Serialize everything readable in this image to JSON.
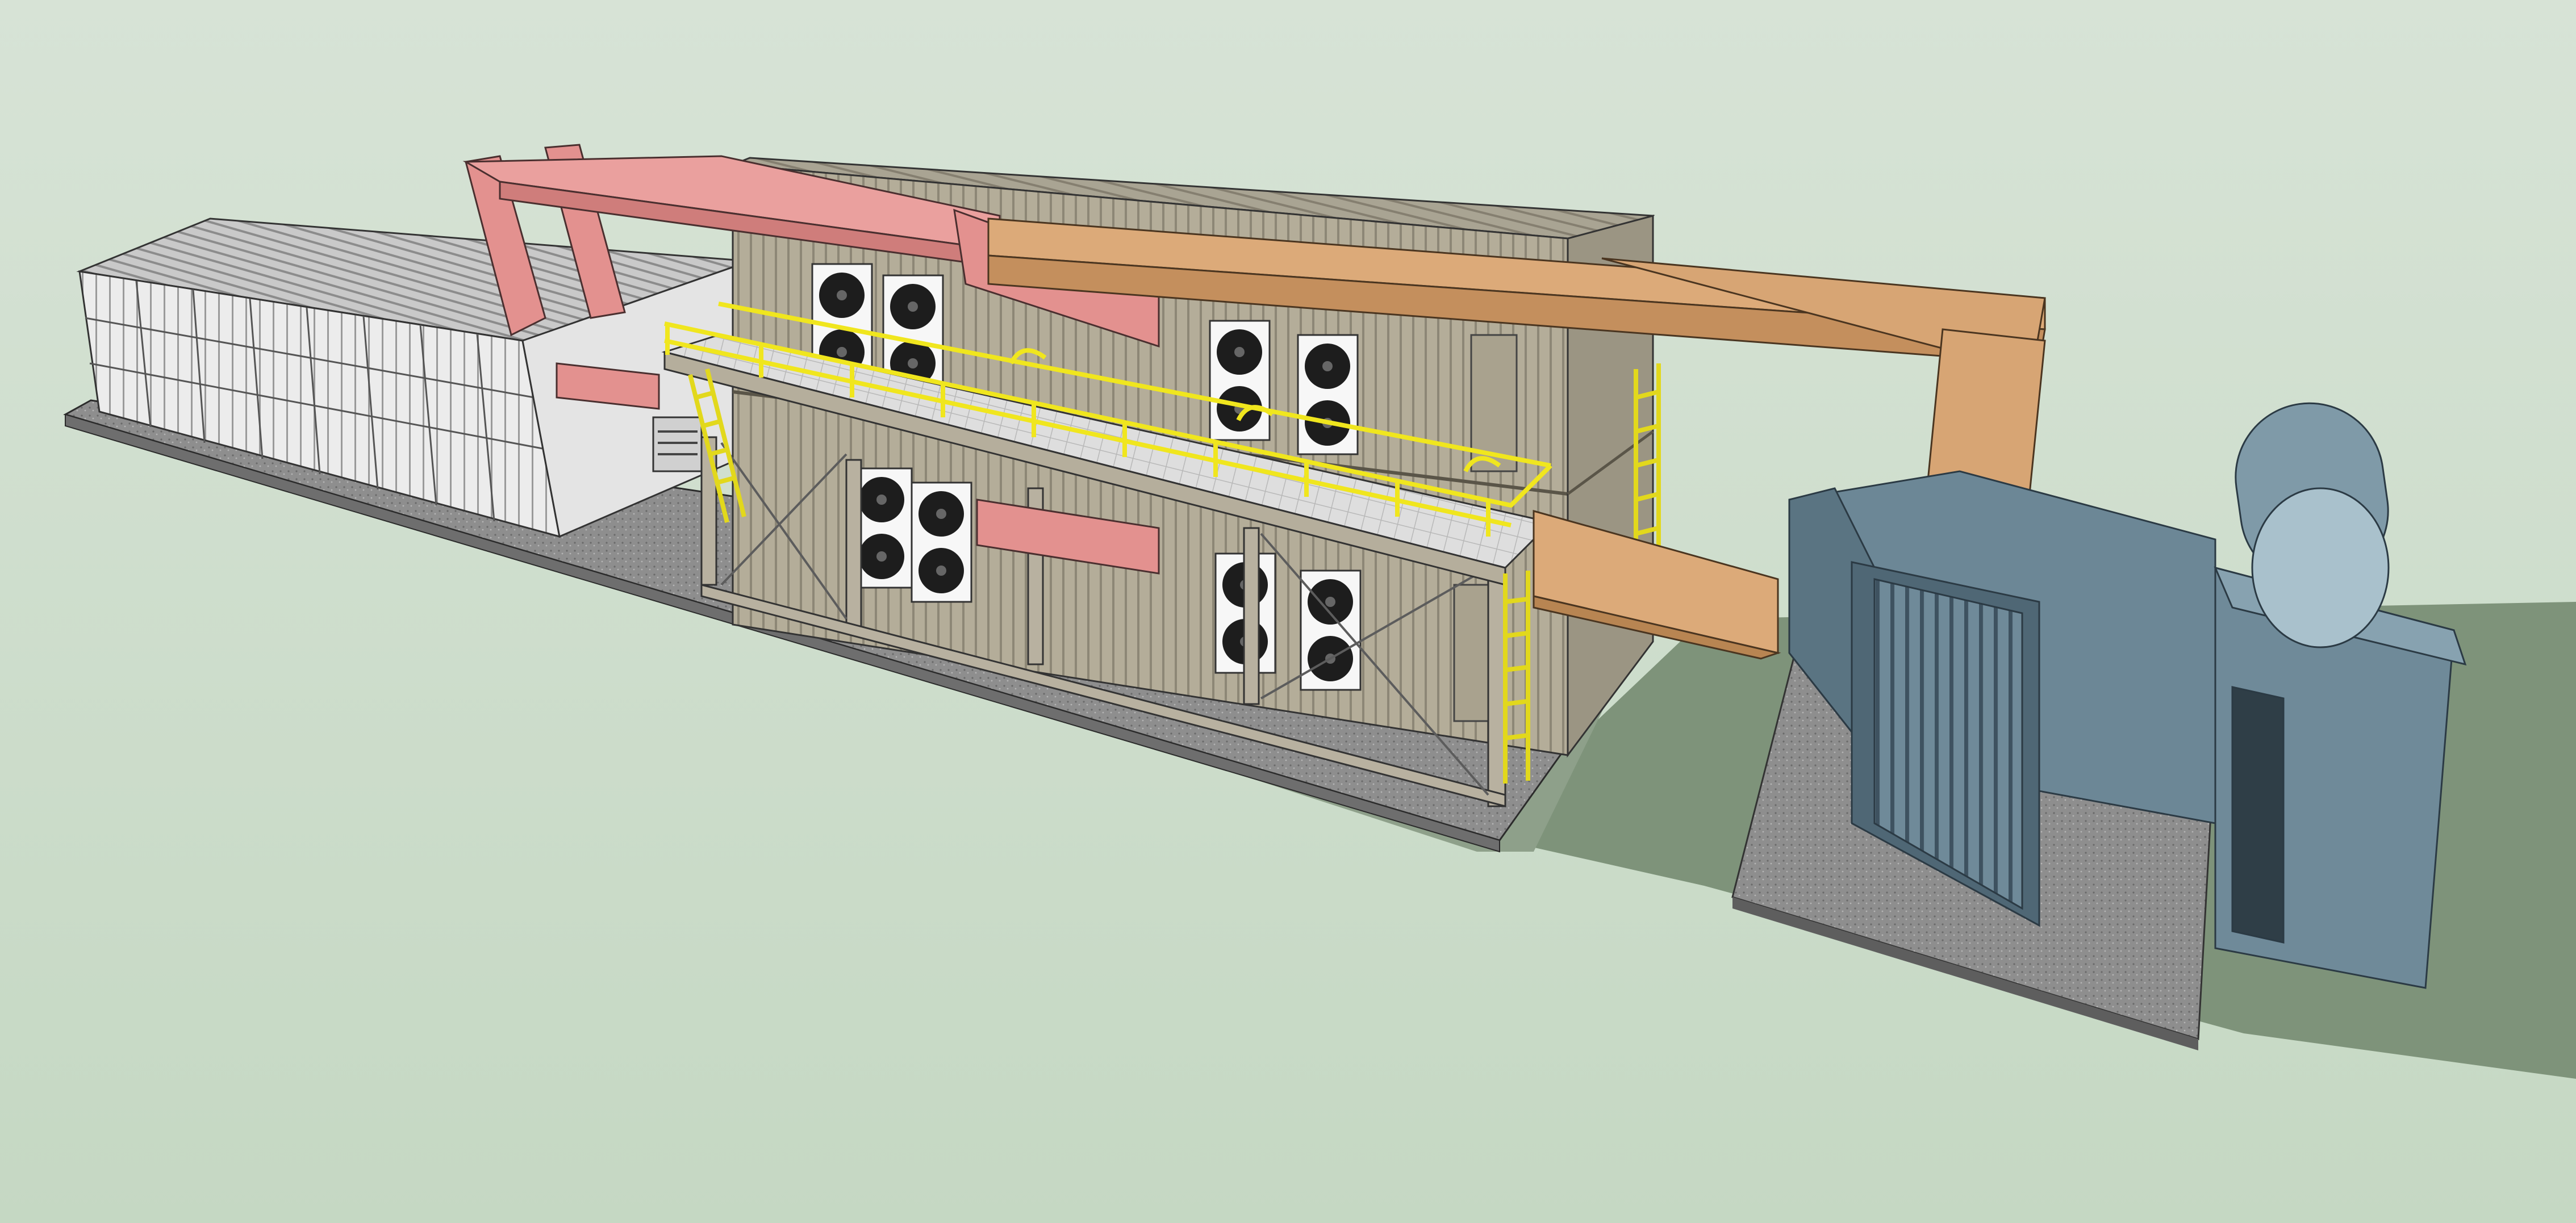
{
  "scene": {
    "kind": "3d-model-render",
    "style": "sketch-shaded",
    "colors": {
      "background_top": "#d7e3d6",
      "background_bottom": "#c5d8c3",
      "ground_shadow": "#7e937a",
      "slab": "#8f8f8f",
      "container_beige": "#b2ab96",
      "container_light": "#f2f2f2",
      "duct_pink": "#e79a98",
      "duct_tan": "#d7a574",
      "walkway": "#d7d7d7",
      "railing_yellow": "#f0e61e",
      "generator_blue": "#6f8a99",
      "ac_unit_white": "#f7f7f7",
      "frame": "#b8b1a0",
      "edge": "#2b2b2b"
    },
    "objects": [
      {
        "name": "white-storage-container",
        "icon": "shipping-container-icon"
      },
      {
        "name": "beige-stacked-containers",
        "icon": "shipping-container-icon"
      },
      {
        "name": "pink-supply-duct",
        "icon": "hvac-duct-icon"
      },
      {
        "name": "tan-exhaust-duct",
        "icon": "hvac-duct-icon"
      },
      {
        "name": "elevated-walkway",
        "icon": "catwalk-icon"
      },
      {
        "name": "yellow-safety-railing",
        "icon": "railing-icon"
      },
      {
        "name": "access-ladders",
        "icon": "ladder-icon"
      },
      {
        "name": "outdoor-ac-units",
        "icon": "fan-unit-icon",
        "count": 8
      },
      {
        "name": "diesel-generator",
        "icon": "generator-icon"
      },
      {
        "name": "radiator-grille",
        "icon": "radiator-icon"
      },
      {
        "name": "fuel-tank",
        "icon": "tank-icon"
      },
      {
        "name": "concrete-foundation",
        "icon": "slab-icon"
      }
    ]
  }
}
